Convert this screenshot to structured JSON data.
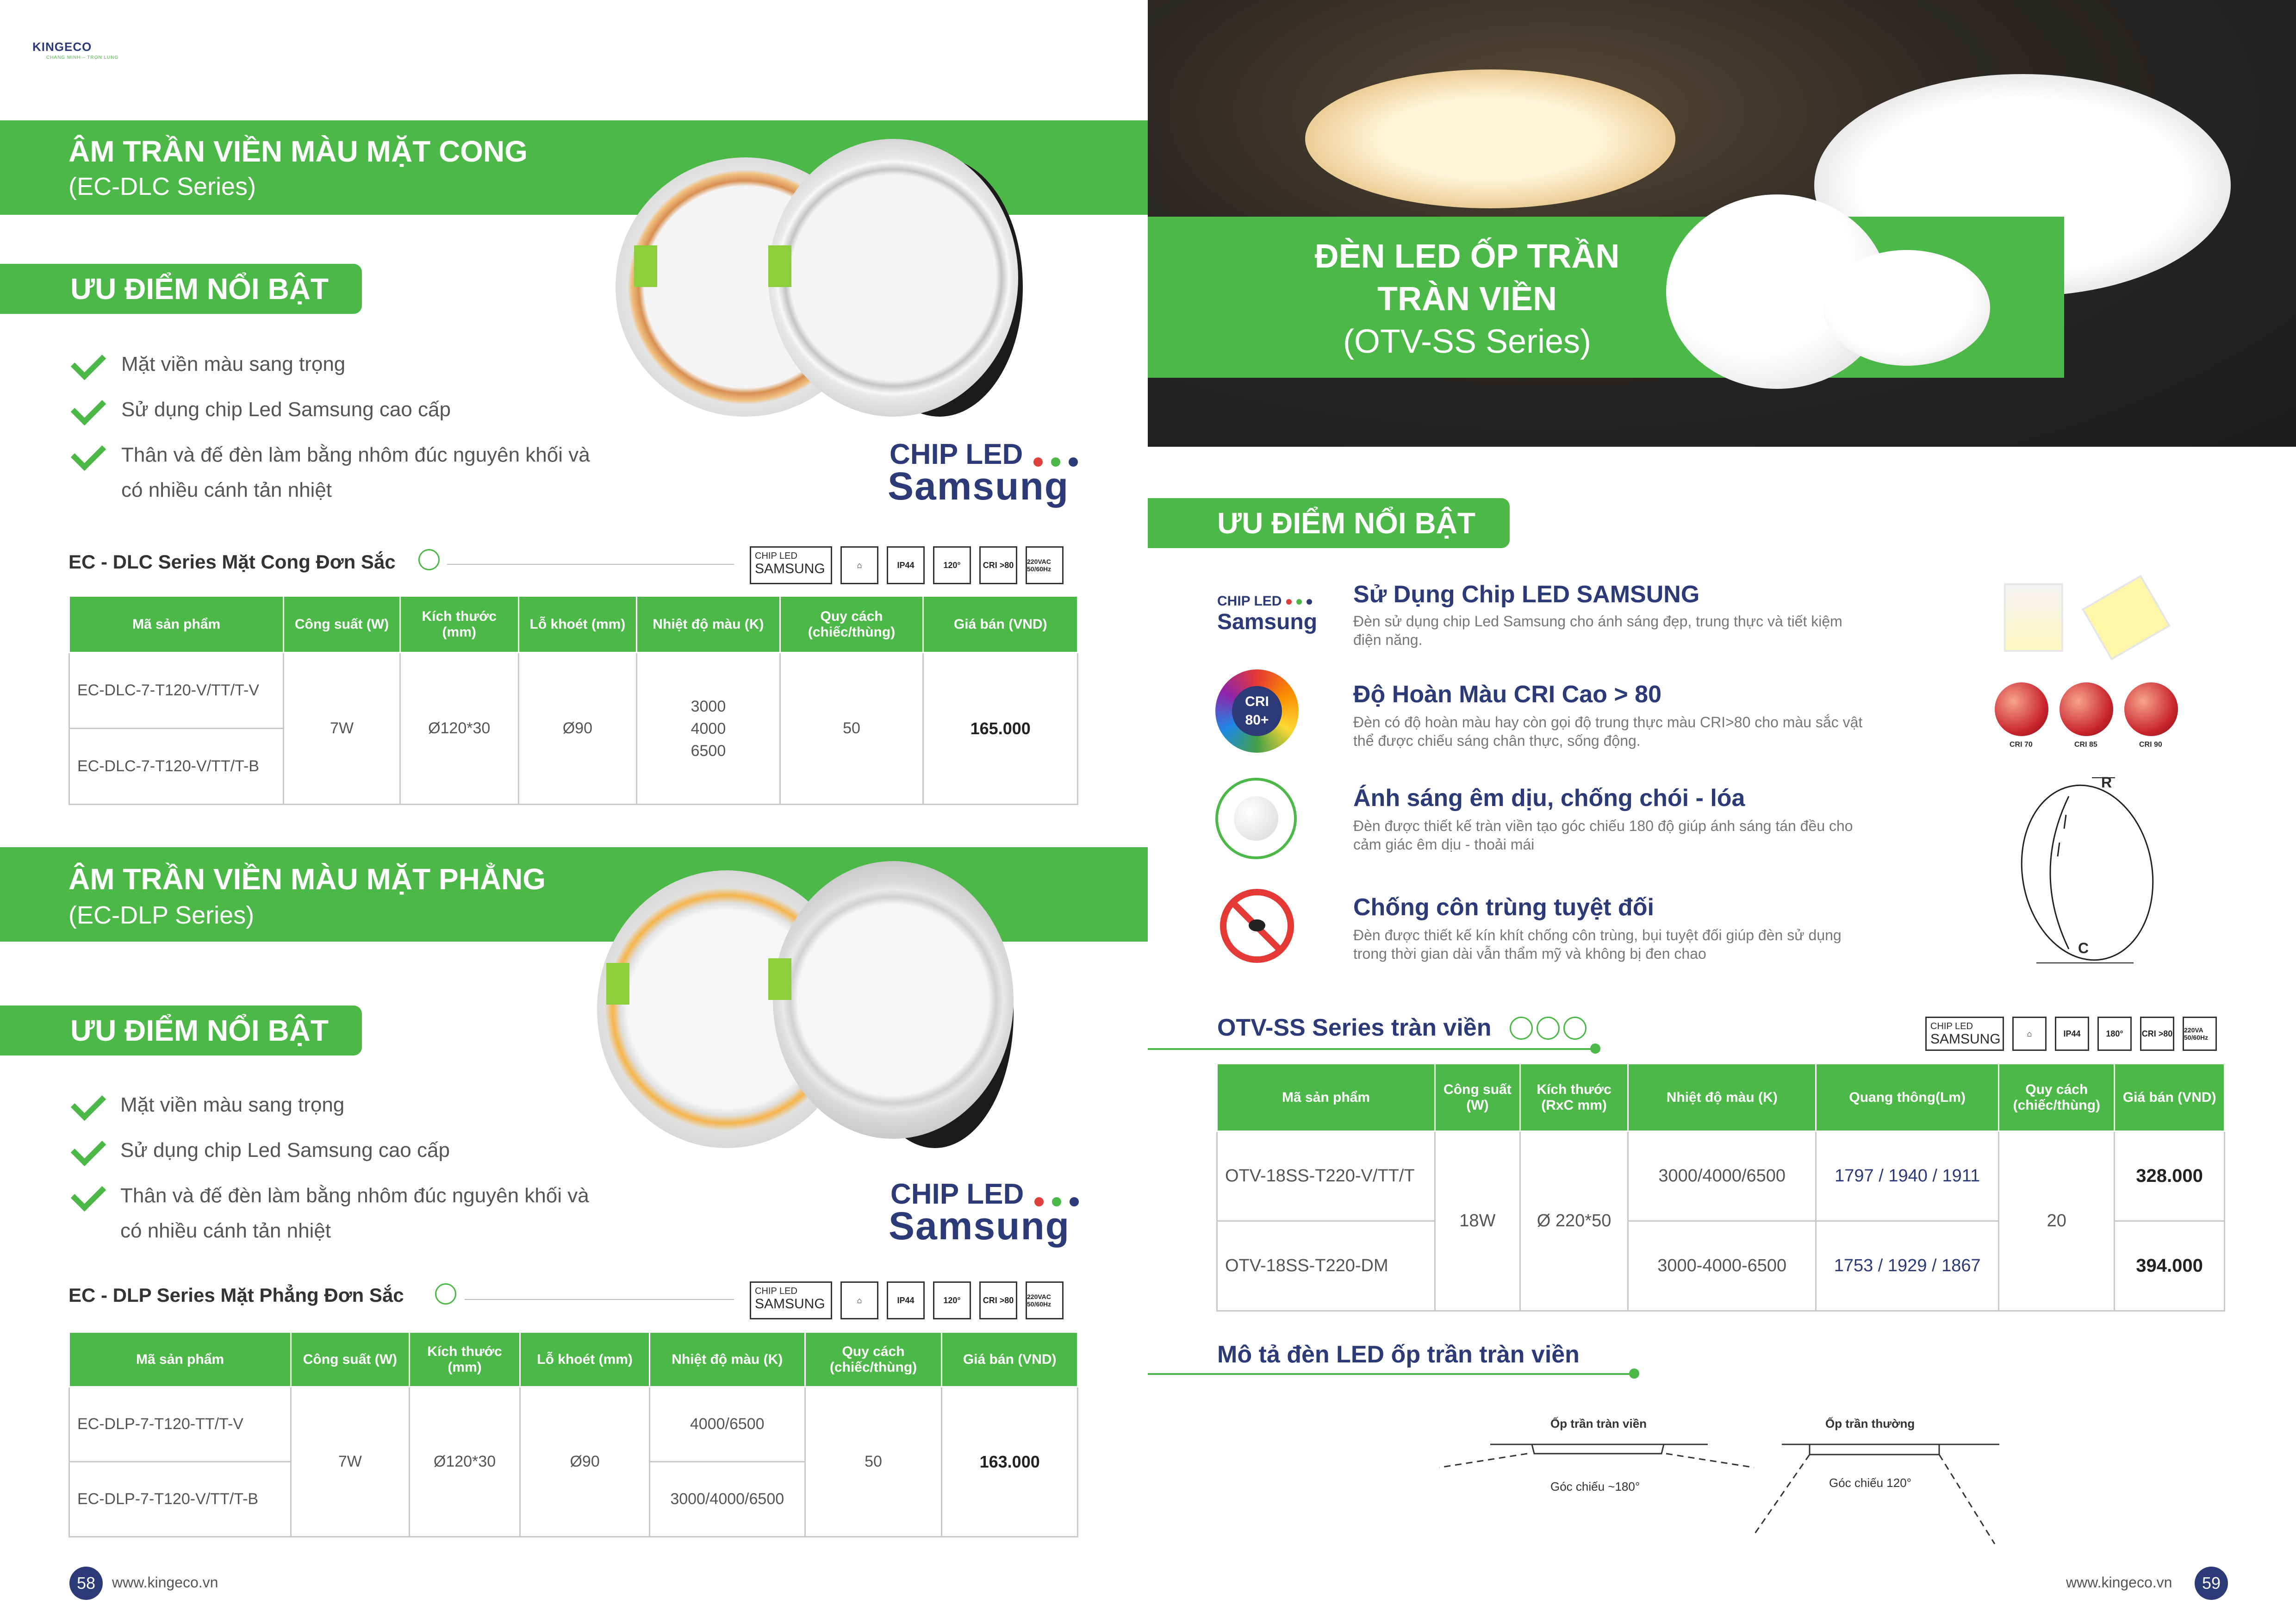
{
  "logo": {
    "name": "KINGECO",
    "tagline": "CHANG MINH – TRỌN LUNG"
  },
  "left": {
    "dlc": {
      "title": "ÂM TRẦN VIỀN MÀU MẶT CONG",
      "series": "(EC-DLC Series)",
      "advantages_tag": "ƯU ĐIỂM NỔI BẬT",
      "bullets": [
        "Mặt viền màu sang trọng",
        "Sử dụng chip Led Samsung cao cấp",
        "Thân và đế đèn làm bằng nhôm đúc nguyên khối và",
        "có nhiều cánh tản nhiệt"
      ],
      "chip_label": "CHIP LED",
      "brand": "Samsung",
      "table_title": "EC - DLC Series Mặt Cong Đơn Sắc",
      "headers": [
        "Mã sản phẩm",
        "Công suất (W)",
        "Kích thước (mm)",
        "Lỗ khoét (mm)",
        "Nhiệt độ màu (K)",
        "Quy cách (chiếc/thùng)",
        "Giá bán (VND)"
      ],
      "codes": [
        "EC-DLC-7-T120-V/TT/T-V",
        "EC-DLC-7-T120-V/TT/T-B"
      ],
      "power": "7W",
      "size": "Ø120*30",
      "cutout": "Ø90",
      "cct": [
        "3000",
        "4000",
        "6500"
      ],
      "pack": "50",
      "price": "165.000"
    },
    "dlp": {
      "title": "ÂM TRẦN VIỀN MÀU MẶT PHẲNG",
      "series": "(EC-DLP Series)",
      "advantages_tag": "ƯU ĐIỂM NỔI BẬT",
      "bullets": [
        "Mặt viền màu sang trọng",
        "Sử dụng chip Led Samsung cao cấp",
        "Thân và đế đèn làm bằng nhôm đúc nguyên khối và",
        "có nhiều cánh tản nhiệt"
      ],
      "chip_label": "CHIP LED",
      "brand": "Samsung",
      "table_title": "EC - DLP Series Mặt Phẳng Đơn Sắc",
      "headers": [
        "Mã sản phẩm",
        "Công suất (W)",
        "Kích thước (mm)",
        "Lỗ khoét (mm)",
        "Nhiệt độ màu (K)",
        "Quy cách (chiếc/thùng)",
        "Giá bán (VND)"
      ],
      "codes": [
        "EC-DLP-7-T120-TT/T-V",
        "EC-DLP-7-T120-V/TT/T-B"
      ],
      "power": "7W",
      "size": "Ø120*30",
      "cutout": "Ø90",
      "cct": [
        "4000/6500",
        "3000/4000/6500"
      ],
      "pack": "50",
      "price": "163.000"
    },
    "spec_icons": {
      "chip": "CHIP LED",
      "chip_brand": "SAMSUNG",
      "ip": "IP44",
      "angle": "120°",
      "cri": "CRI >80",
      "voltage": "220VAC 50/60Hz"
    },
    "page_number": "58",
    "website": "www.kingeco.vn"
  },
  "right": {
    "hero_title_1": "ĐÈN LED ỐP TRẦN",
    "hero_title_2": "TRÀN VIỀN",
    "hero_series": "(OTV-SS Series)",
    "advantages_tag": "ƯU ĐIỂM NỔI BẬT",
    "features": [
      {
        "title": "Sử Dụng Chip LED SAMSUNG",
        "desc1": "Đèn sử dụng chip Led Samsung cho ánh sáng đẹp, trung thực và tiết kiệm",
        "desc2": "điện năng."
      },
      {
        "title": "Độ Hoàn Màu CRI Cao > 80",
        "desc1": "Đèn có độ hoàn màu hay còn gọi độ trung thực màu CRI>80 cho màu sắc vật",
        "desc2": "thể được chiếu sáng chân thực, sống động."
      },
      {
        "title": "Ánh sáng êm dịu, chống chói - lóa",
        "desc1": "Đèn được thiết kế tràn viền tạo góc chiếu 180 độ giúp ánh sáng tán đều cho",
        "desc2": "cảm giác êm dịu - thoải mái"
      },
      {
        "title": "Chống côn trùng tuyệt đối",
        "desc1": "Đèn được thiết kế kín khít chống côn trùng, bụi tuyệt đối giúp đèn sử dụng",
        "desc2": "trong thời gian dài vẫn thẩm mỹ và không bị đen chao"
      }
    ],
    "chip_label": "CHIP LED",
    "brand": "Samsung",
    "cri_badge": "CRI 80+",
    "apple_labels": [
      "CRI 70",
      "CRI 85",
      "CRI 90"
    ],
    "dim_labels": [
      "R",
      "C"
    ],
    "table_title": "OTV-SS Series tràn viền",
    "headers": [
      "Mã sản phẩm",
      "Công suất (W)",
      "Kích thước (RxC mm)",
      "Nhiệt độ màu (K)",
      "Quang thông(Lm)",
      "Quy cách (chiếc/thùng)",
      "Giá bán (VND)"
    ],
    "rows": [
      {
        "code": "OTV-18SS-T220-V/TT/T",
        "cct": "3000/4000/6500",
        "lumen": "1797 / 1940 / 1911",
        "price": "328.000"
      },
      {
        "code": "OTV-18SS-T220-DM",
        "cct": "3000-4000-6500",
        "lumen": "1753 / 1929 / 1867",
        "price": "394.000"
      }
    ],
    "power": "18W",
    "size": "Ø 220*50",
    "pack": "20",
    "spec_icons": {
      "chip": "CHIP LED",
      "chip_brand": "SAMSUNG",
      "ip": "IP44",
      "angle": "180°",
      "cri": "CRI >80",
      "voltage": "220VA 50/60Hz"
    },
    "desc_title": "Mô tả đèn LED ốp trần tràn viền",
    "diagram": {
      "left_label": "Ốp trần tràn viền",
      "left_angle": "Góc chiếu ~180°",
      "right_label": "Ốp trần thường",
      "right_angle": "Góc chiếu 120°"
    },
    "page_number": "59",
    "website": "www.kingeco.vn"
  },
  "colors": {
    "brand_green": "#4bb847",
    "brand_navy": "#2c3a78"
  }
}
